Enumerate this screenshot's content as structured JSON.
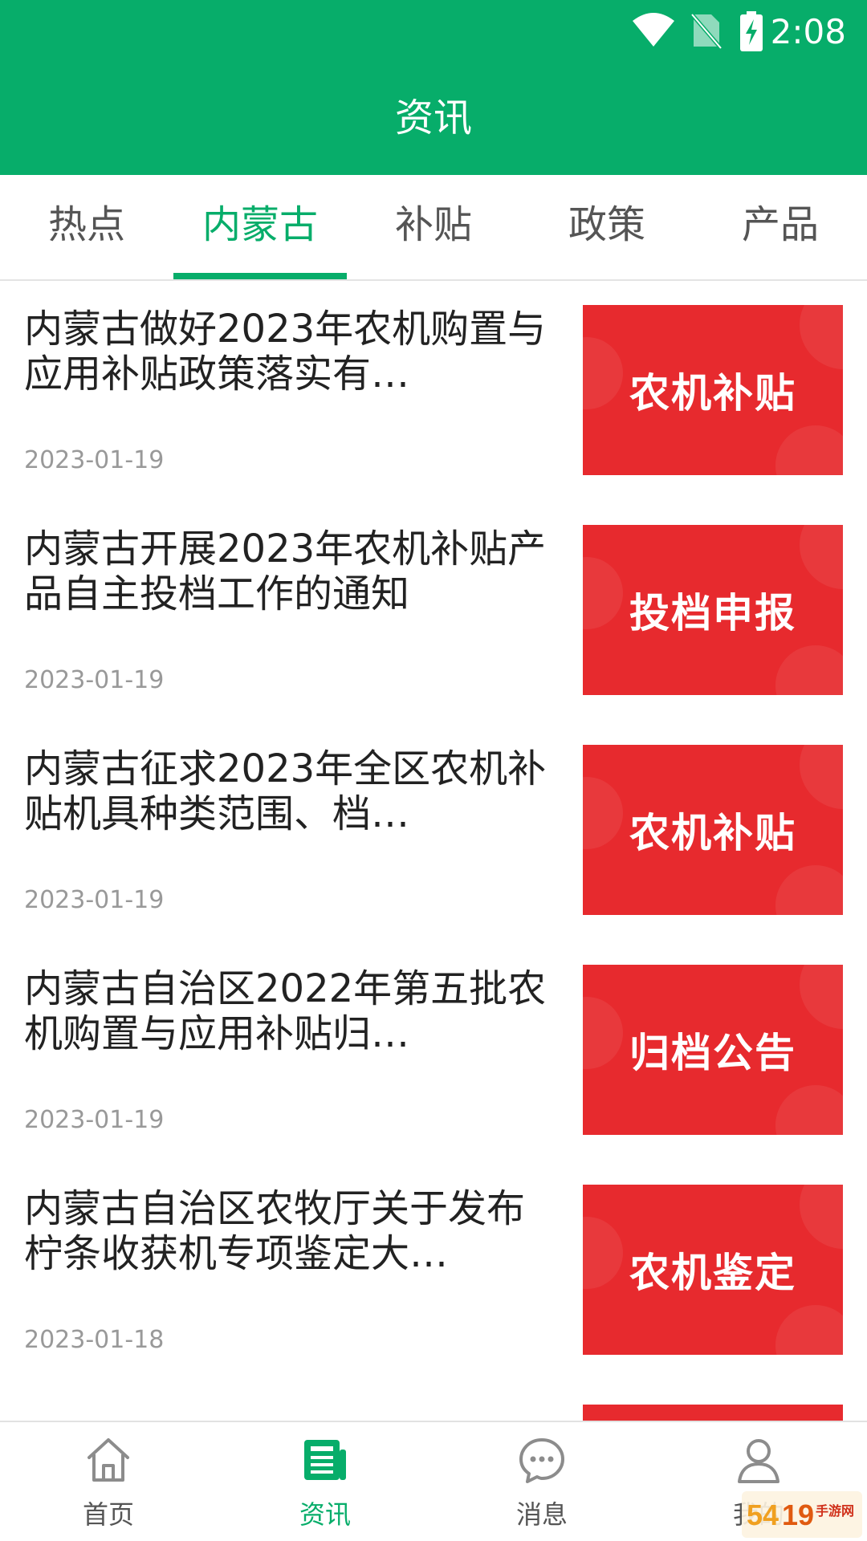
{
  "status_bar": {
    "time": "2:08"
  },
  "header": {
    "title": "资讯"
  },
  "tabs": [
    {
      "label": "热点"
    },
    {
      "label": "内蒙古",
      "active": true
    },
    {
      "label": "补贴"
    },
    {
      "label": "政策"
    },
    {
      "label": "产品"
    }
  ],
  "news": [
    {
      "title": "内蒙古做好2023年农机购置与应用补贴政策落实有…",
      "date": "2023-01-19",
      "thumb_text": "农机补贴"
    },
    {
      "title": "内蒙古开展2023年农机补贴产品自主投档工作的通知",
      "date": "2023-01-19",
      "thumb_text": "投档申报"
    },
    {
      "title": "内蒙古征求2023年全区农机补贴机具种类范围、档…",
      "date": "2023-01-19",
      "thumb_text": "农机补贴"
    },
    {
      "title": "内蒙古自治区2022年第五批农机购置与应用补贴归…",
      "date": "2023-01-19",
      "thumb_text": "归档公告"
    },
    {
      "title": "内蒙古自治区农牧厅关于发布柠条收获机专项鉴定大…",
      "date": "2023-01-18",
      "thumb_text": "农机鉴定"
    },
    {
      "title": "",
      "date": "",
      "thumb_text": ""
    }
  ],
  "bottom_nav": [
    {
      "label": "首页",
      "icon": "home-icon"
    },
    {
      "label": "资讯",
      "icon": "news-icon",
      "active": true
    },
    {
      "label": "消息",
      "icon": "message-icon"
    },
    {
      "label": "我的",
      "icon": "user-icon"
    }
  ],
  "watermark": {
    "text": "5419手游网"
  },
  "colors": {
    "primary": "#07ad6a",
    "thumb_red": "#e72a2e",
    "text": "#222222",
    "date": "#999999",
    "inactive": "#555555"
  }
}
